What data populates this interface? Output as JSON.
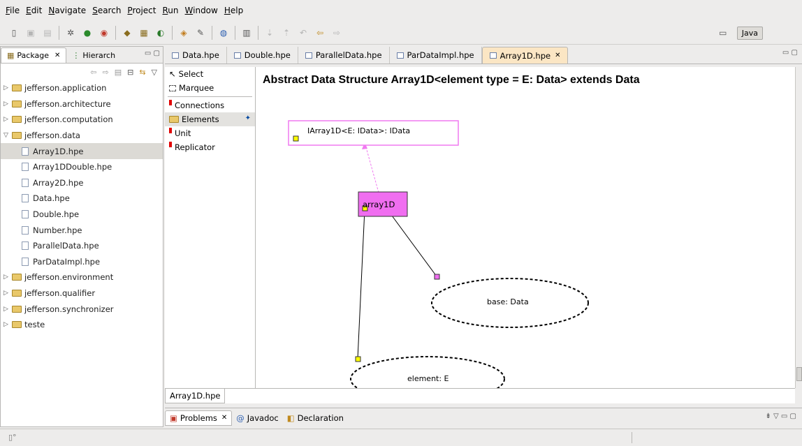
{
  "menu": [
    "File",
    "Edit",
    "Navigate",
    "Search",
    "Project",
    "Run",
    "Window",
    "Help"
  ],
  "perspective": {
    "label": "Java"
  },
  "left_tabs": {
    "package": "Package",
    "hierarchy": "Hierarch"
  },
  "tree": {
    "jefferson_application": "jefferson.application",
    "jefferson_architecture": "jefferson.architecture",
    "jefferson_computation": "jefferson.computation",
    "jefferson_data": "jefferson.data",
    "files": [
      "Array1D.hpe",
      "Array1DDouble.hpe",
      "Array2D.hpe",
      "Data.hpe",
      "Double.hpe",
      "Number.hpe",
      "ParallelData.hpe",
      "ParDataImpl.hpe"
    ],
    "jefferson_environment": "jefferson.environment",
    "jefferson_qualifier": "jefferson.qualifier",
    "jefferson_synchronizer": "jefferson.synchronizer",
    "teste": "teste"
  },
  "editor_tabs": [
    "Data.hpe",
    "Double.hpe",
    "ParallelData.hpe",
    "ParDataImpl.hpe",
    "Array1D.hpe"
  ],
  "palette": {
    "select": "Select",
    "marquee": "Marquee",
    "connections": "Connections",
    "elements": "Elements",
    "unit": "Unit",
    "replicator": "Replicator"
  },
  "canvas": {
    "title": "Abstract Data Structure Array1D<element type = E: Data> extends Data",
    "interface_box": "IArray1D<E: IData>: IData",
    "unit_box": "array1D",
    "ellipse_base": "base: Data",
    "ellipse_element": "element: E"
  },
  "editor_bottom_tab": "Array1D.hpe",
  "bottom_tabs": {
    "problems": "Problems",
    "javadoc": "Javadoc",
    "declaration": "Declaration"
  },
  "colors": {
    "unit_fill": "#f06ef0",
    "interface_border": "#f07af0",
    "active_tab": "#fbe6c4"
  }
}
